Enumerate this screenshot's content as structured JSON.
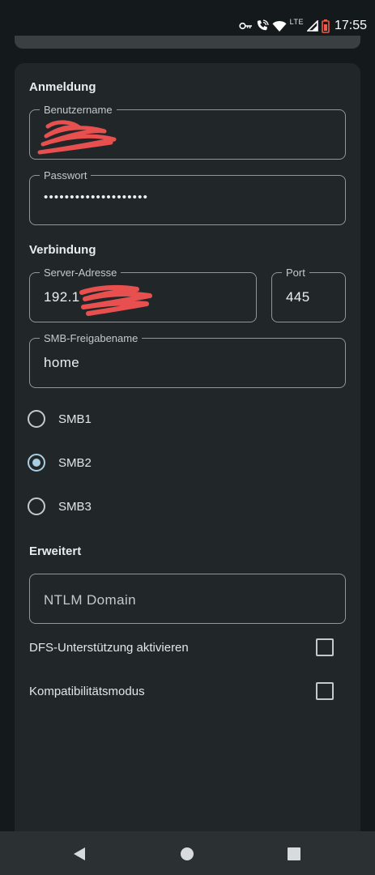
{
  "status_bar": {
    "icons": [
      "key-icon",
      "wifi-calling-icon",
      "wifi-icon",
      "lte-signal-icon",
      "battery-icon"
    ],
    "network_label": "LTE",
    "time": "17:55"
  },
  "login": {
    "section_title": "Anmeldung",
    "username": {
      "label": "Benutzername",
      "value": ""
    },
    "password": {
      "label": "Passwort",
      "value": "••••••••••••••••••••"
    }
  },
  "connection": {
    "section_title": "Verbindung",
    "server": {
      "label": "Server-Adresse",
      "value": "192.1"
    },
    "port": {
      "label": "Port",
      "value": "445"
    },
    "share": {
      "label": "SMB-Freigabename",
      "value": "home"
    },
    "protocols": [
      {
        "label": "SMB1",
        "selected": false
      },
      {
        "label": "SMB2",
        "selected": true
      },
      {
        "label": "SMB3",
        "selected": false
      }
    ]
  },
  "advanced": {
    "section_title": "Erweitert",
    "ntlm_domain": {
      "placeholder": "NTLM Domain",
      "value": ""
    },
    "dfs": {
      "label": "DFS-Unterstützung aktivieren",
      "checked": false
    },
    "compat": {
      "label": "Kompatibilitätsmodus",
      "checked": false
    }
  },
  "nav": {
    "buttons": [
      "back-icon",
      "home-icon",
      "recents-icon"
    ]
  },
  "colors": {
    "background": "#14191b",
    "card": "#212729",
    "outline": "#8e969a",
    "accent": "#a9cde2",
    "redaction": "#e8504f",
    "battery": "#f0594a"
  }
}
